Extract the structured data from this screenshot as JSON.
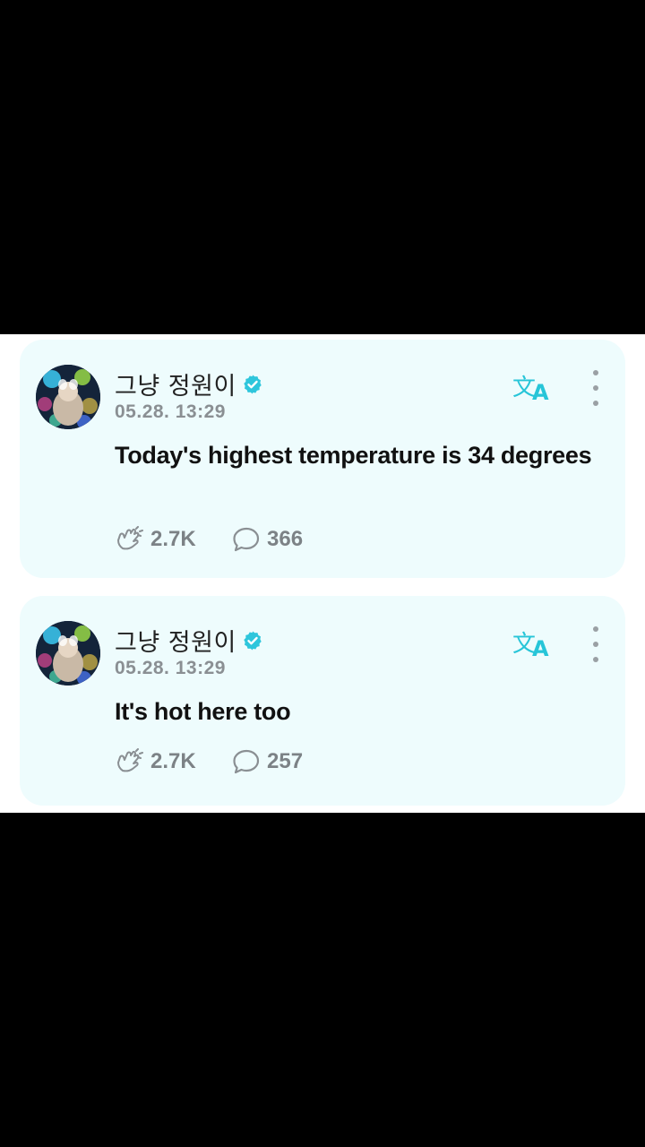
{
  "posts": [
    {
      "author": "그냥 정원이",
      "timestamp": "05.28. 13:29",
      "text": "Today's highest temperature is 34 degrees",
      "likes": "2.7K",
      "comments": "366"
    },
    {
      "author": "그냥 정원이",
      "timestamp": "05.28. 13:29",
      "text": "It's hot here too",
      "likes": "2.7K",
      "comments": "257"
    }
  ],
  "icons": {
    "avatar": "avatar-photo",
    "verified": "verified-badge-icon",
    "translate": "translate-icon",
    "more": "more-vertical-icon",
    "like": "cheer-hand-icon",
    "comment": "comment-bubble-icon"
  },
  "colors": {
    "card_background": "#eefcfd",
    "accent": "#27c5d8",
    "verified": "#2ec6dc",
    "muted_text": "#8a8f93",
    "body_text": "#111111"
  }
}
